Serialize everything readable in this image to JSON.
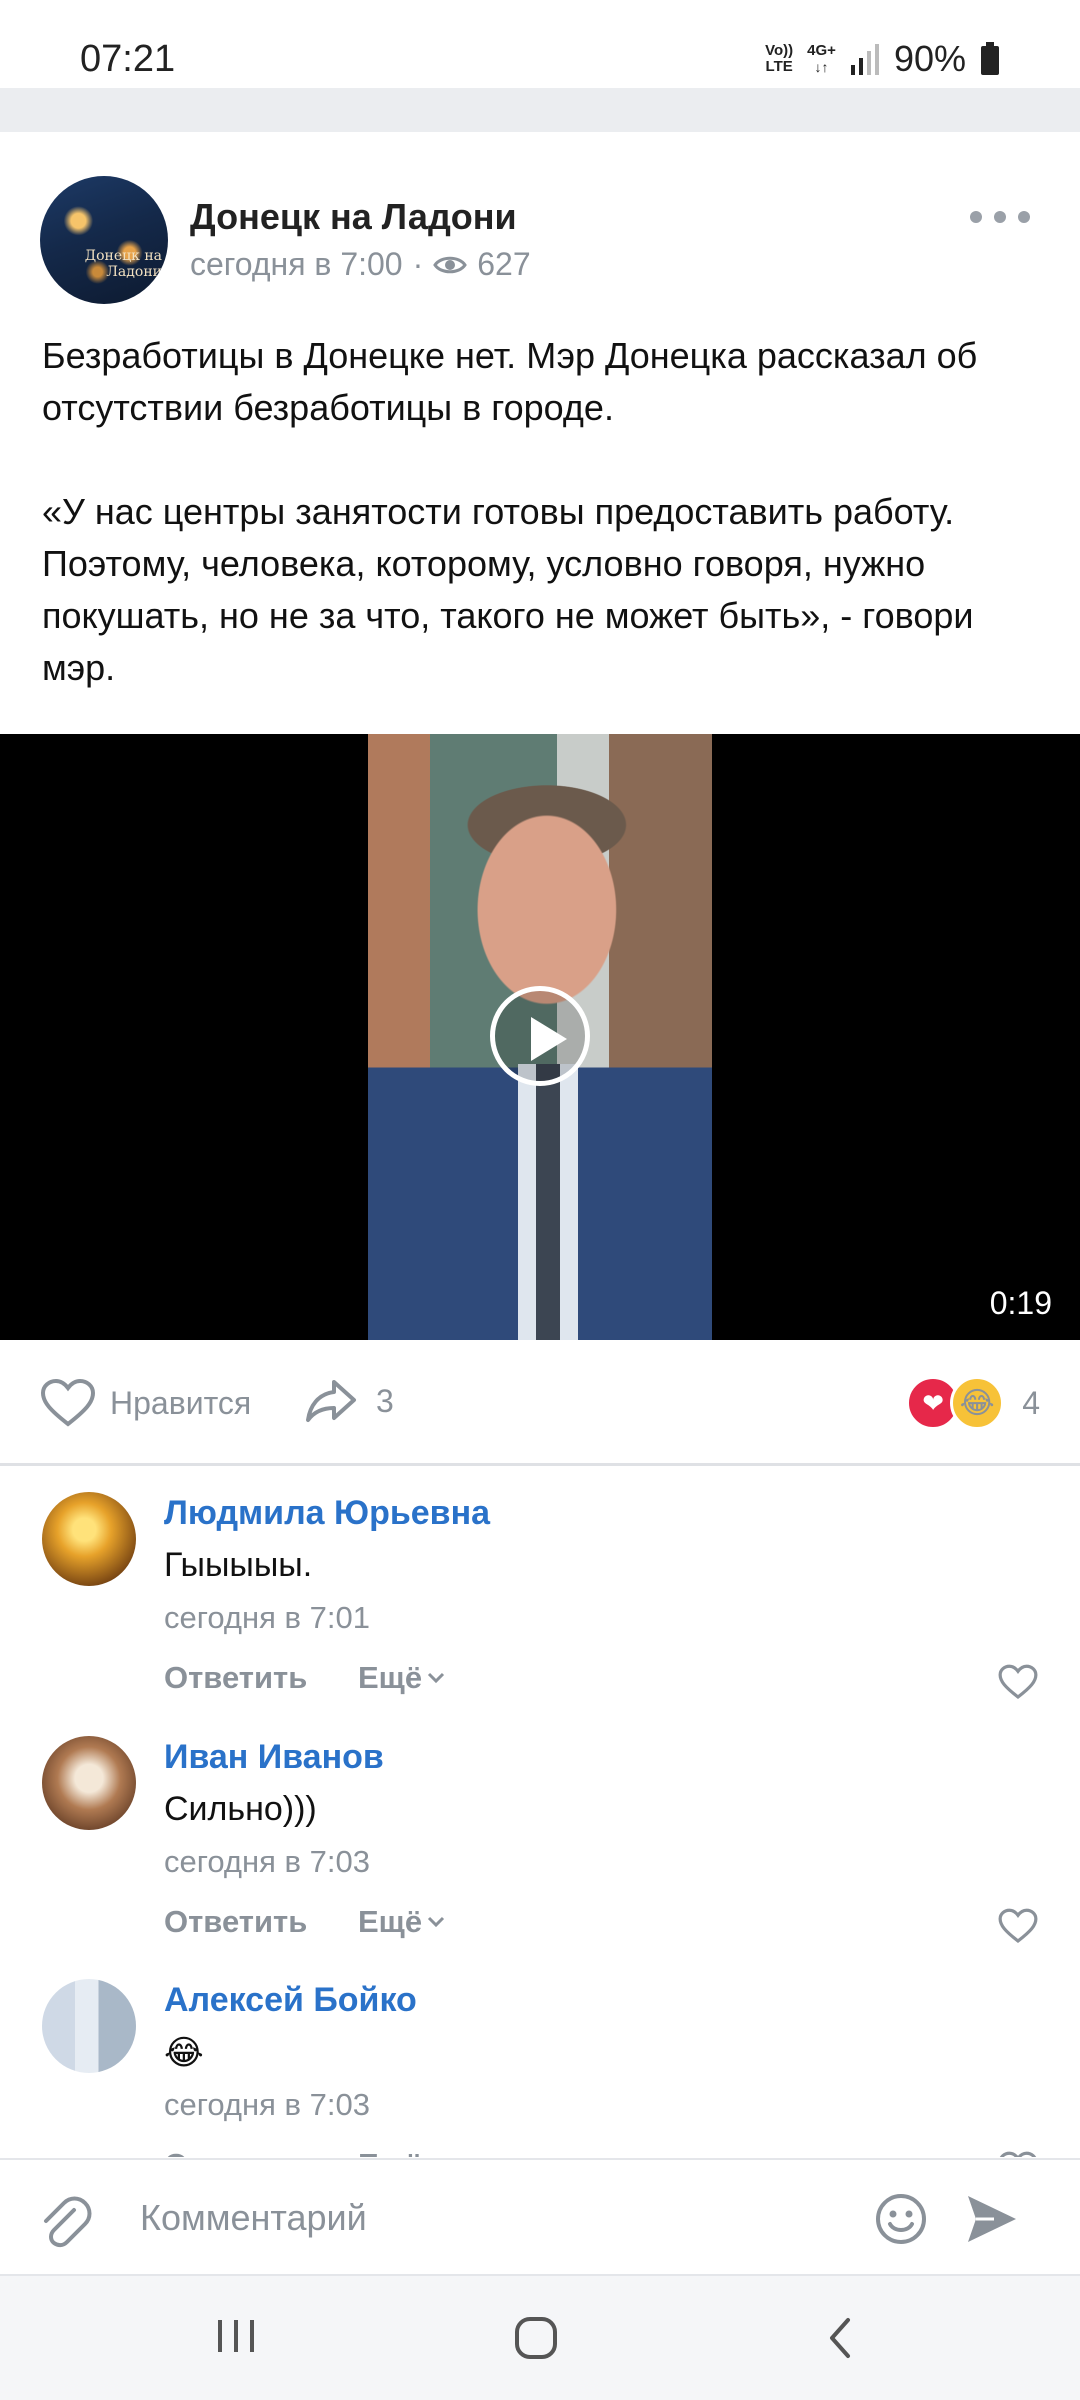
{
  "status_bar": {
    "time": "07:21",
    "network_top": "Vo))",
    "network_bottom": "LTE",
    "network_type": "4G+",
    "battery": "90%"
  },
  "post": {
    "group_name": "Донецк на Ладони",
    "avatar_text": "Донецк на Ладони",
    "time": "сегодня в 7:00",
    "separator": "·",
    "views": "627",
    "paragraph_1": "Безработицы в Донецке нет. Мэр Донецка рассказал об отсутствии безработицы в городе.",
    "paragraph_2": "«У нас центры занятости готовы предоставить работу. Поэтому, человека, которому, условно говоря, нужно покушать, но не за что, такого не может быть», - говори мэр.",
    "video_duration": "0:19"
  },
  "actions": {
    "like_label": "Нравится",
    "share_count": "3",
    "reactions_count": "4"
  },
  "comments": [
    {
      "author": "Людмила Юрьевна",
      "text": "Гыыыыы.",
      "time": "сегодня в 7:01",
      "reply": "Ответить",
      "more": "Ещё"
    },
    {
      "author": "Иван Иванов",
      "text": "Сильно)))",
      "time": "сегодня в 7:03",
      "reply": "Ответить",
      "more": "Ещё"
    },
    {
      "author": "Алексей Бойко",
      "text": "😂",
      "time": "сегодня в 7:03",
      "reply": "Ответить",
      "more": "Ещё"
    }
  ],
  "input": {
    "placeholder": "Комментарий"
  },
  "colors": {
    "accent": "#2a72c9",
    "muted": "#8a9199",
    "heart": "#e6284a"
  }
}
